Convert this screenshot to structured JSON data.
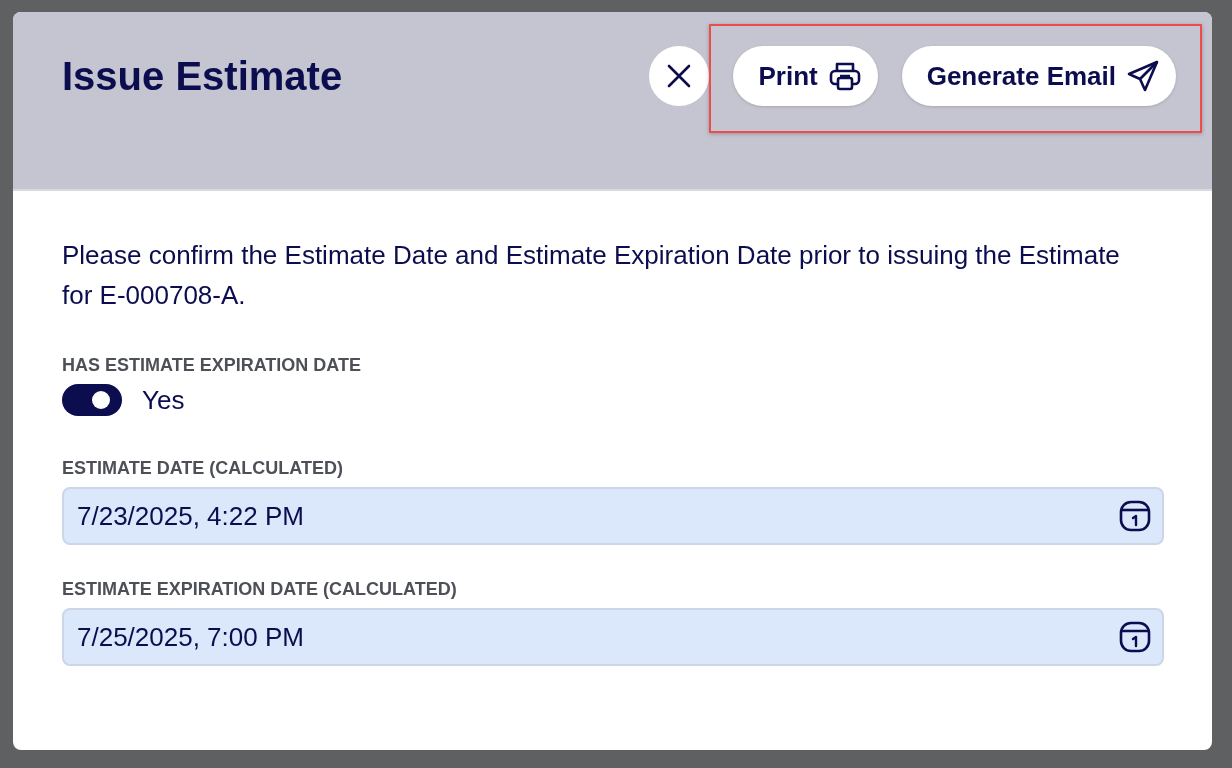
{
  "dialog": {
    "title": "Issue Estimate",
    "actions": [
      {
        "label": "Print",
        "kind": "print"
      },
      {
        "label": "Generate Email",
        "kind": "email"
      }
    ],
    "message": "Please confirm the Estimate Date and Estimate Expiration Date prior to issuing the Estimate for E-000708-A.",
    "toggle": {
      "label": "HAS ESTIMATE EXPIRATION DATE",
      "on": true,
      "value_text": "Yes"
    },
    "fields": [
      {
        "label": "ESTIMATE DATE (CALCULATED)",
        "value": "7/23/2025, 4:22 PM"
      },
      {
        "label": "ESTIMATE EXPIRATION DATE (CALCULATED)",
        "value": "7/25/2025, 7:00 PM"
      }
    ]
  }
}
